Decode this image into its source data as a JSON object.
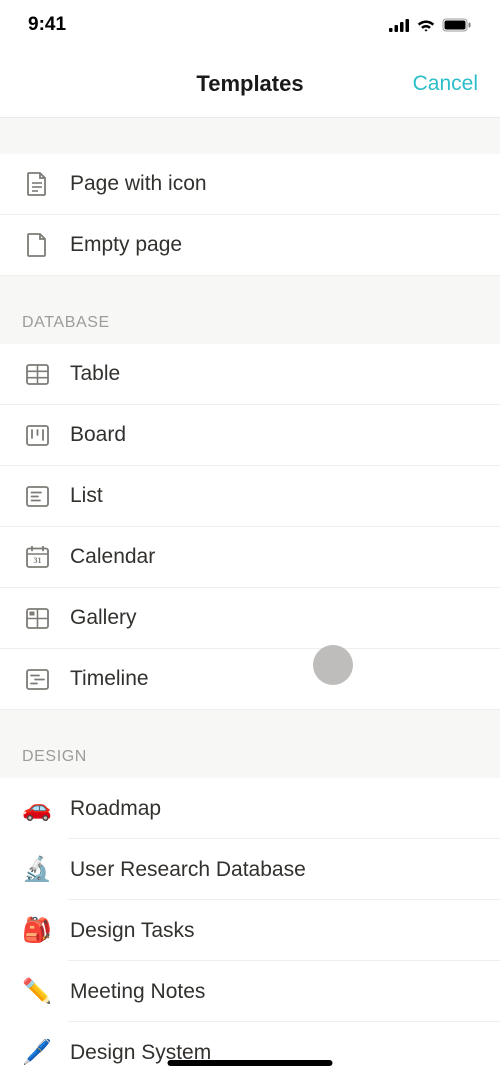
{
  "status": {
    "time": "9:41"
  },
  "nav": {
    "title": "Templates",
    "cancel": "Cancel"
  },
  "basics": {
    "items": [
      {
        "label": "Page with icon"
      },
      {
        "label": "Empty page"
      }
    ]
  },
  "database": {
    "header": "DATABASE",
    "items": [
      {
        "label": "Table"
      },
      {
        "label": "Board"
      },
      {
        "label": "List"
      },
      {
        "label": "Calendar"
      },
      {
        "label": "Gallery"
      },
      {
        "label": "Timeline"
      }
    ]
  },
  "design": {
    "header": "DESIGN",
    "items": [
      {
        "emoji": "🚗",
        "label": "Roadmap"
      },
      {
        "emoji": "🔬",
        "label": "User Research Database"
      },
      {
        "emoji": "🎒",
        "label": "Design Tasks"
      },
      {
        "emoji": "✏️",
        "label": "Meeting Notes"
      },
      {
        "emoji": "🖊️",
        "label": "Design System"
      }
    ]
  }
}
